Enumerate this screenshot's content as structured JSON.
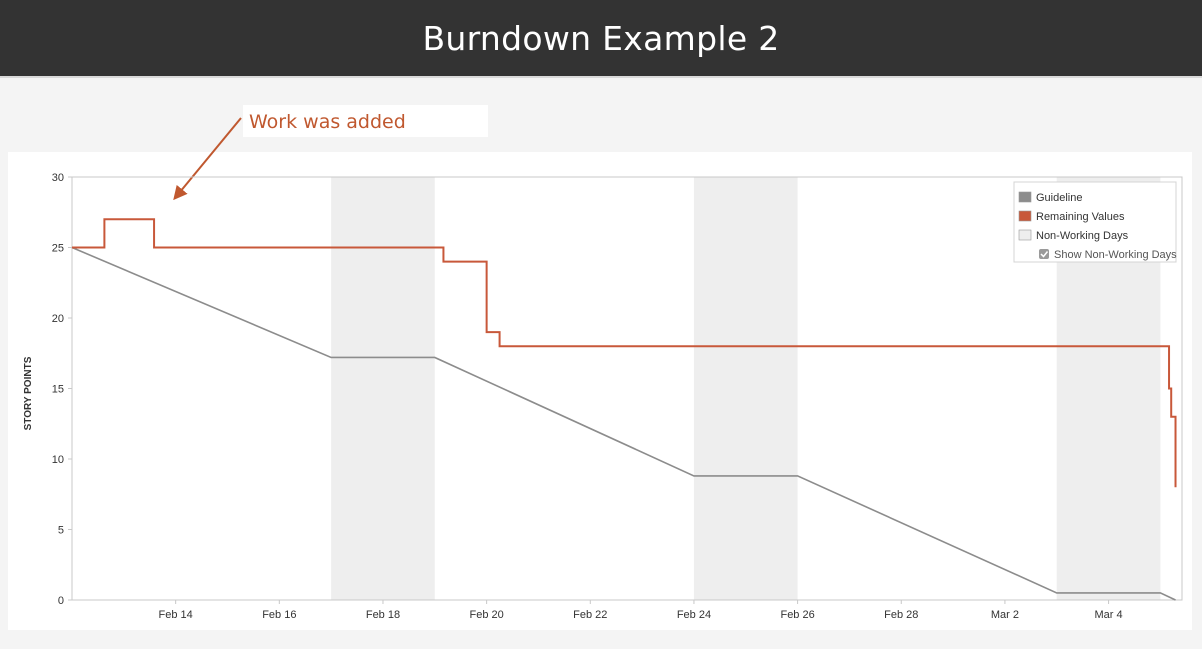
{
  "header": {
    "title": "Burndown Example 2"
  },
  "annotation": {
    "text": "Work was added",
    "color": "#c0582f"
  },
  "chart_data": {
    "type": "line",
    "title": "",
    "xlabel": "",
    "ylabel": "STORY POINTS",
    "ylim": [
      0,
      30
    ],
    "yticks": [
      0,
      5,
      10,
      15,
      20,
      25,
      30
    ],
    "xlim": [
      "2014-02-12",
      "2014-03-05T10:00"
    ],
    "xtick_labels": [
      "Feb 14",
      "Feb 16",
      "Feb 18",
      "Feb 20",
      "Feb 22",
      "Feb 24",
      "Feb 26",
      "Feb 28",
      "Mar 2",
      "Mar 4"
    ],
    "xtick_dates": [
      "2014-02-14",
      "2014-02-16",
      "2014-02-18",
      "2014-02-20",
      "2014-02-22",
      "2014-02-24",
      "2014-02-26",
      "2014-02-28",
      "2014-03-02",
      "2014-03-04"
    ],
    "non_working_days": [
      [
        "2014-02-17",
        "2014-02-19"
      ],
      [
        "2014-02-24",
        "2014-02-26"
      ],
      [
        "2014-03-03",
        "2014-03-05"
      ]
    ],
    "grid": false,
    "legend_position": "top-right",
    "series": [
      {
        "name": "Guideline",
        "color": "#8c8c8c",
        "step": false,
        "points": [
          [
            "2014-02-12",
            25
          ],
          [
            "2014-02-17",
            17.2
          ],
          [
            "2014-02-19",
            17.2
          ],
          [
            "2014-02-24",
            8.8
          ],
          [
            "2014-02-26",
            8.8
          ],
          [
            "2014-03-03",
            0.5
          ],
          [
            "2014-03-05",
            0.5
          ],
          [
            "2014-03-05T07:00",
            0
          ]
        ]
      },
      {
        "name": "Remaining Values",
        "color": "#c8583a",
        "step": true,
        "points": [
          [
            "2014-02-12",
            25
          ],
          [
            "2014-02-12T15:00",
            27
          ],
          [
            "2014-02-13T14:00",
            25
          ],
          [
            "2014-02-19T04:00",
            24
          ],
          [
            "2014-02-20",
            19
          ],
          [
            "2014-02-20T06:00",
            18
          ],
          [
            "2014-03-05T04:00",
            15
          ],
          [
            "2014-03-05T05:00",
            13
          ],
          [
            "2014-03-05T07:00",
            8
          ]
        ]
      }
    ],
    "legend": {
      "items": [
        {
          "label": "Guideline",
          "color": "#8c8c8c"
        },
        {
          "label": "Remaining Values",
          "color": "#c8583a"
        },
        {
          "label": "Non-Working Days",
          "color": "#eeeeee"
        }
      ],
      "toggle_label": "Show Non-Working Days",
      "toggle_checked": true
    }
  }
}
